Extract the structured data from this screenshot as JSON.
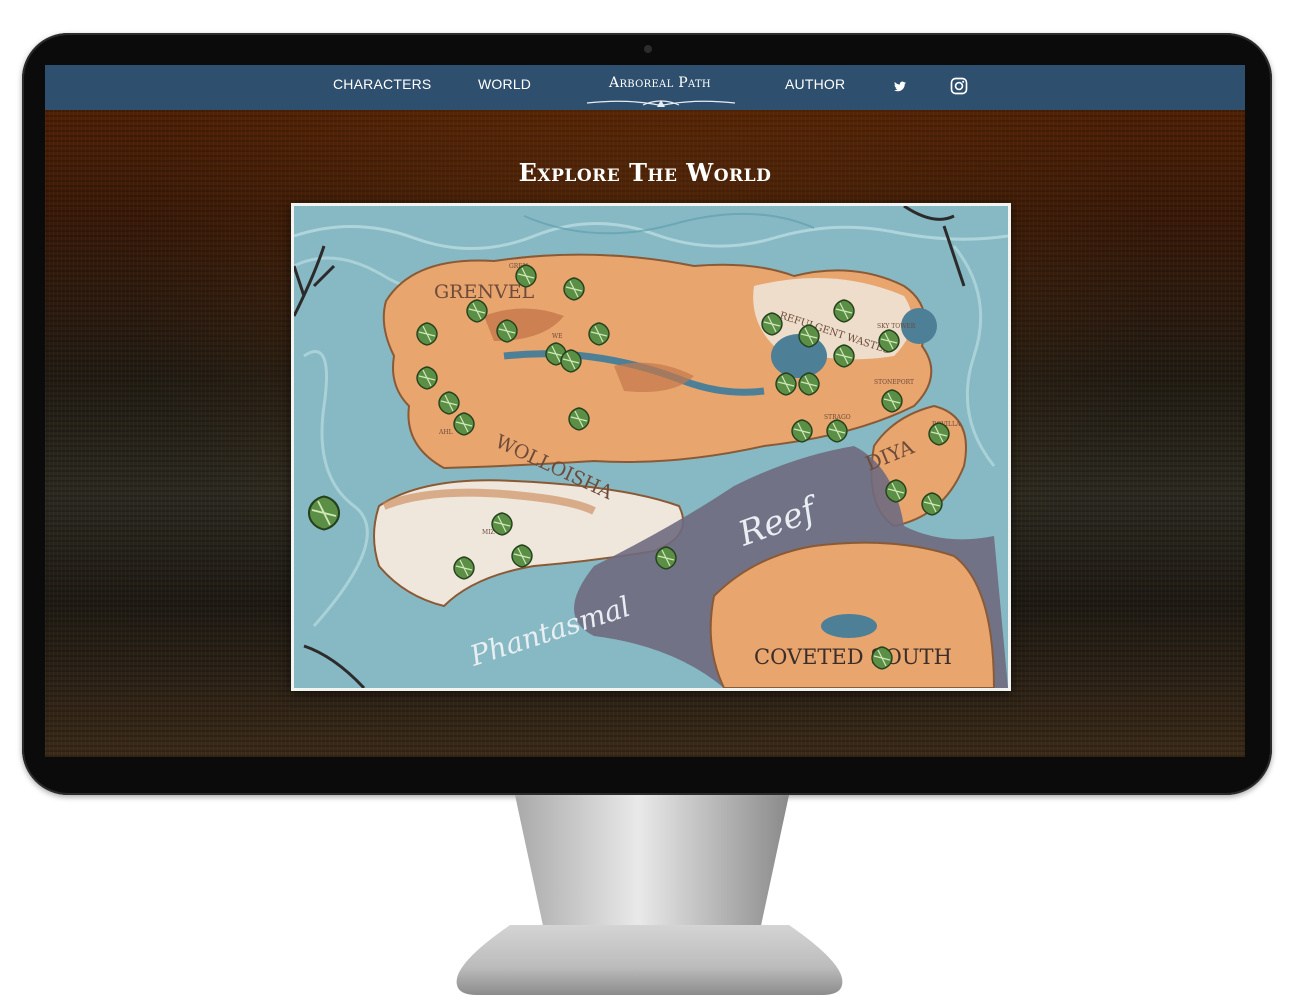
{
  "nav": {
    "characters": "CHARACTERS",
    "world": "WORLD",
    "brand": "Arboreal Path",
    "author": "AUTHOR",
    "twitter_icon": "twitter-icon",
    "instagram_icon": "instagram-icon"
  },
  "main": {
    "title": "Explore The World"
  },
  "map": {
    "regions": [
      "GRENVEL",
      "REFULGENT WASTES",
      "WOLLOISHA",
      "DIYA",
      "Reef",
      "Phantasmal",
      "COVETED SOUTH"
    ],
    "places": [
      "GREN",
      "WE",
      "MIZ",
      "AHL",
      "STRAGO",
      "STONEPORT",
      "ROVILLA",
      "SKY TOWER"
    ],
    "marker_icon": "leaf-marker-icon",
    "colors": {
      "land": "#e8a56e",
      "sea": "#86b9c3",
      "reef": "#6f6a80",
      "snow": "#efe6dc"
    }
  }
}
